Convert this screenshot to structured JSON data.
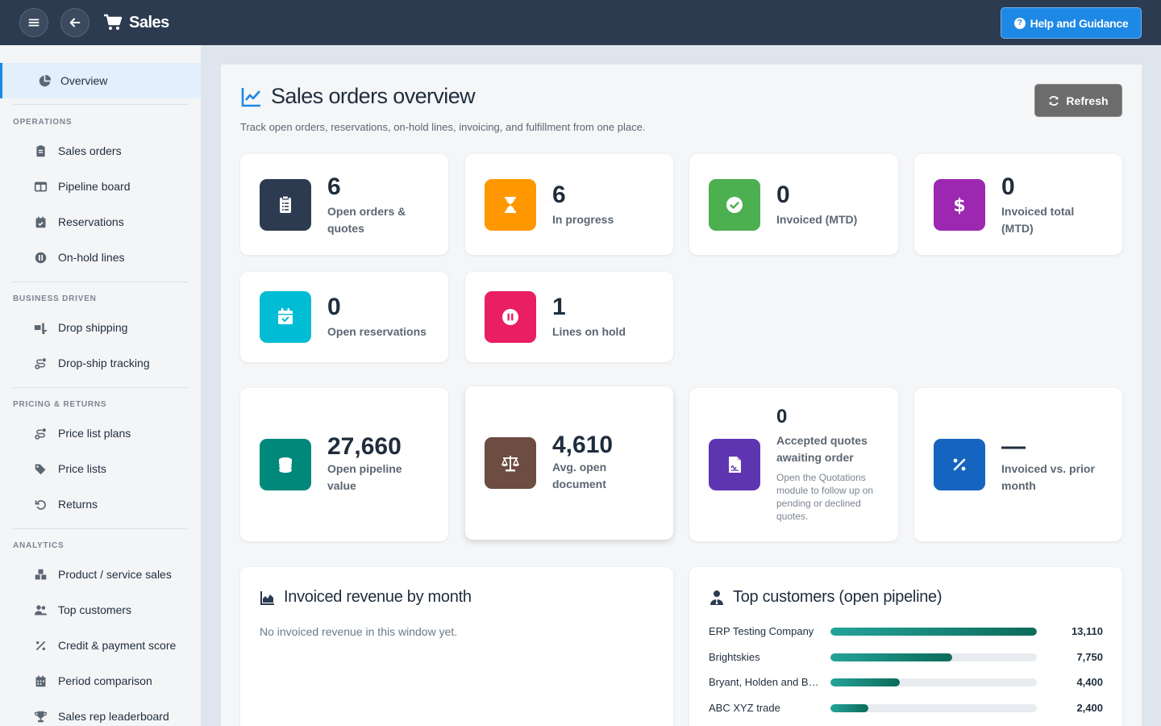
{
  "header": {
    "app_title": "Sales",
    "help_label": "Help and Guidance"
  },
  "sidebar": {
    "overview": "Overview",
    "sections": [
      {
        "label": "OPERATIONS",
        "items": [
          "Sales orders",
          "Pipeline board",
          "Reservations",
          "On-hold lines"
        ]
      },
      {
        "label": "BUSINESS DRIVEN",
        "items": [
          "Drop shipping",
          "Drop-ship tracking"
        ]
      },
      {
        "label": "PRICING & RETURNS",
        "items": [
          "Price list plans",
          "Price lists",
          "Returns"
        ]
      },
      {
        "label": "ANALYTICS",
        "items": [
          "Product / service sales",
          "Top customers",
          "Credit & payment score",
          "Period comparison",
          "Sales rep leaderboard"
        ]
      }
    ]
  },
  "page": {
    "title": "Sales orders overview",
    "subtitle": "Track open orders, reservations, on-hold lines, invoicing, and fulfillment from one place.",
    "refresh_label": "Refresh"
  },
  "kpis": [
    {
      "value": "6",
      "label": "Open orders & quotes",
      "color": "#2c3b50",
      "icon": "clipboard-list-icon"
    },
    {
      "value": "6",
      "label": "In progress",
      "color": "#ff9800",
      "icon": "hourglass-icon"
    },
    {
      "value": "0",
      "label": "Invoiced (MTD)",
      "color": "#4caf50",
      "icon": "check-circle-icon"
    },
    {
      "value": "0",
      "label": "Invoiced total (MTD)",
      "color": "#9c27b0",
      "icon": "dollar-icon"
    },
    {
      "value": "0",
      "label": "Open reservations",
      "color": "#00bcd4",
      "icon": "calendar-check-icon"
    },
    {
      "value": "1",
      "label": "Lines on hold",
      "color": "#e91e63",
      "icon": "pause-circle-icon"
    }
  ],
  "metrics": [
    {
      "value": "27,660",
      "label": "Open pipeline value",
      "color": "#00897b",
      "icon": "coins-icon"
    },
    {
      "value": "4,610",
      "label": "Avg. open document",
      "color": "#6d4c41",
      "icon": "balance-scale-icon"
    },
    {
      "value": "0",
      "label": "Accepted quotes awaiting order",
      "note": "Open the Quotations module to follow up on pending or declined quotes.",
      "color": "#5e35b1",
      "icon": "file-contract-icon"
    },
    {
      "value": "—",
      "label": "Invoiced vs. prior month",
      "color": "#1565c0",
      "icon": "percent-icon"
    }
  ],
  "revenue_panel": {
    "title": "Invoiced revenue by month",
    "empty_text": "No invoiced revenue in this window yet."
  },
  "customers_panel": {
    "title": "Top customers (open pipeline)",
    "rows": [
      {
        "name": "ERP Testing Company",
        "value": "13,110",
        "amount": 13110
      },
      {
        "name": "Brightskies",
        "value": "7,750",
        "amount": 7750
      },
      {
        "name": "Bryant, Holden and Ba...",
        "value": "4,400",
        "amount": 4400
      },
      {
        "name": "ABC XYZ trade",
        "value": "2,400",
        "amount": 2400
      }
    ]
  }
}
